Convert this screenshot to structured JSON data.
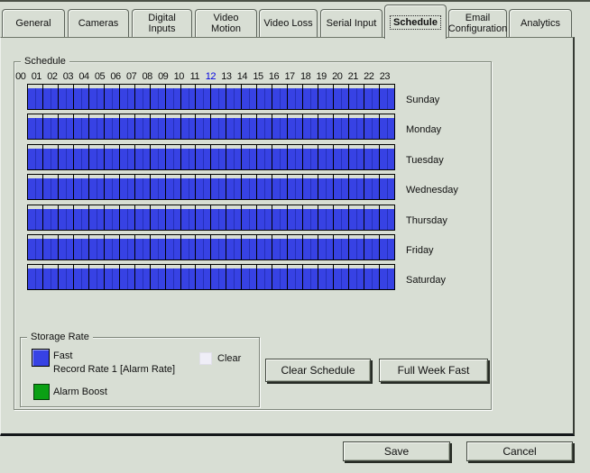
{
  "tab_bar": {
    "tabs": [
      {
        "label": "General",
        "selected": false
      },
      {
        "label": "Cameras",
        "selected": false
      },
      {
        "label": "Digital Inputs",
        "selected": false
      },
      {
        "label": "Video Motion",
        "selected": false
      },
      {
        "label": "Video Loss",
        "selected": false
      },
      {
        "label": "Serial Input",
        "selected": false
      },
      {
        "label": "Schedule",
        "selected": true
      },
      {
        "label": "Email Configuration",
        "selected": false
      },
      {
        "label": "Analytics",
        "selected": false
      }
    ]
  },
  "schedule": {
    "group_label": "Schedule",
    "hour_labels": [
      "00",
      "01",
      "02",
      "03",
      "04",
      "05",
      "06",
      "07",
      "08",
      "09",
      "10",
      "11",
      "12",
      "13",
      "14",
      "15",
      "16",
      "17",
      "18",
      "19",
      "20",
      "21",
      "22",
      "23"
    ],
    "highlighted_hour": "12",
    "day_labels": [
      "Sunday",
      "Monday",
      "Tuesday",
      "Wednesday",
      "Thursday",
      "Friday",
      "Saturday"
    ],
    "grid": {
      "rows": 7,
      "columns": 24,
      "all_cells": "fast"
    }
  },
  "storage_rate": {
    "group_label": "Storage Rate",
    "legend": [
      {
        "key": "fast",
        "label": "Fast",
        "sublabel": "Record Rate 1 [Alarm Rate]",
        "color": "#3742e4"
      },
      {
        "key": "clear",
        "label": "Clear",
        "color": "#efeef7"
      },
      {
        "key": "alarm_boost",
        "label": "Alarm Boost",
        "color": "#0aa014"
      }
    ],
    "buttons": {
      "clear_schedule": "Clear Schedule",
      "full_week_fast": "Full Week Fast"
    }
  },
  "footer": {
    "save": "Save",
    "cancel": "Cancel"
  },
  "colors": {
    "background": "#d8ded4",
    "schedule_fast": "#3742e4",
    "half_hour_line": "#2430b8",
    "alarm_boost": "#0aa014",
    "clear": "#efeef7",
    "highlighted_hour_text": "#0000e0",
    "grid_border": "#000000"
  }
}
